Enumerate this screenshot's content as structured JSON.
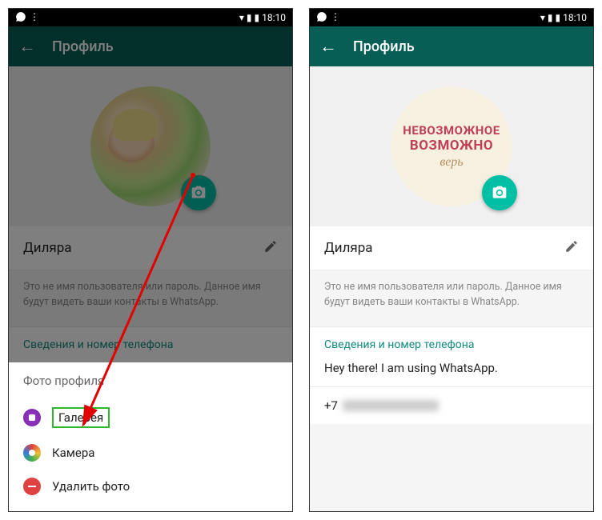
{
  "statusBar": {
    "time": "18:10"
  },
  "appBar": {
    "title": "Профиль"
  },
  "profile": {
    "name": "Диляра",
    "info": "Это не имя пользователя или пароль. Данное имя будут видеть ваши контакты в WhatsApp.",
    "sectionTitle": "Сведения и номер телефона",
    "statusText": "Hey there! I am using WhatsApp.",
    "phonePrefix": "+7"
  },
  "avatarText": {
    "line1": "НЕВОЗМОЖНОЕ",
    "line2": "ВОЗМОЖНО",
    "line3": "верь"
  },
  "sheet": {
    "title": "Фото профиля",
    "items": [
      {
        "label": "Галерея"
      },
      {
        "label": "Камера"
      },
      {
        "label": "Удалить фото"
      }
    ]
  }
}
